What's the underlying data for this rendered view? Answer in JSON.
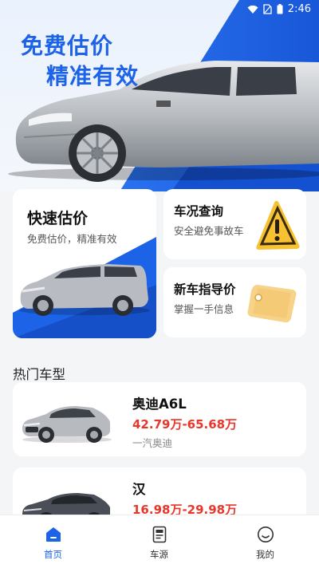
{
  "status_bar": {
    "time": "2:46"
  },
  "hero": {
    "line1": "免费估价",
    "line2": "精准有效"
  },
  "feature_cards": {
    "quick_valuation": {
      "title": "快速估价",
      "subtitle": "免费估价，精准有效"
    },
    "car_check": {
      "title": "车况查询",
      "subtitle": "安全避免事故车"
    },
    "new_car_guide": {
      "title": "新车指导价",
      "subtitle": "掌握一手信息"
    }
  },
  "hot_models": {
    "title": "热门车型",
    "items": [
      {
        "name": "奥迪A6L",
        "price": "42.79万-65.68万",
        "brand": "一汽奥迪"
      },
      {
        "name": "汉",
        "price": "16.98万-29.98万",
        "brand": ""
      }
    ]
  },
  "tab_bar": {
    "items": [
      {
        "label": "首页",
        "icon": "home-icon",
        "active": true
      },
      {
        "label": "车源",
        "icon": "document-icon",
        "active": false
      },
      {
        "label": "我的",
        "icon": "smiley-icon",
        "active": false
      }
    ]
  },
  "colors": {
    "primary": "#1d63e8",
    "price": "#e8372a",
    "background": "#f4f5f7",
    "warning": "#f6c232"
  }
}
